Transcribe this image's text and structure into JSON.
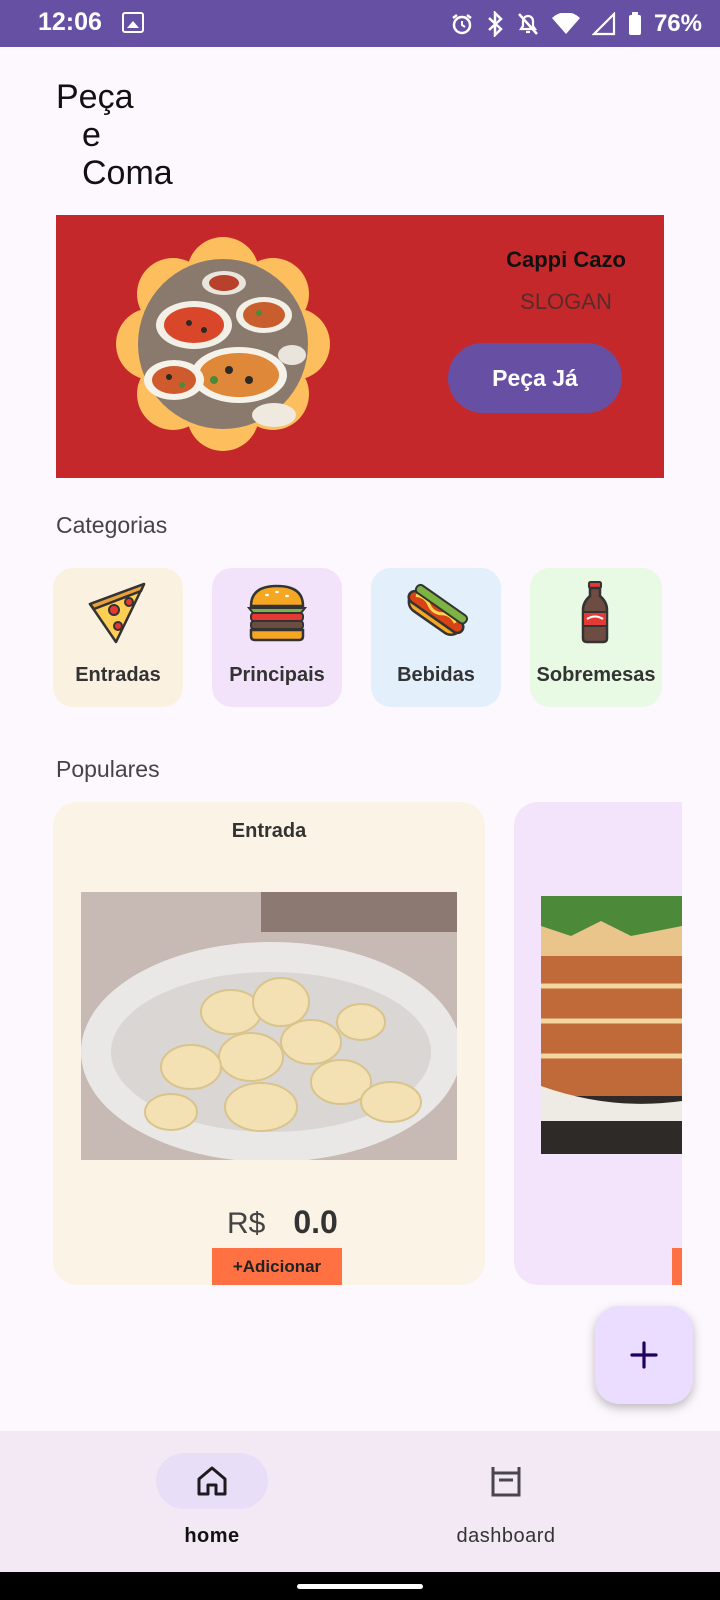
{
  "status_bar": {
    "time": "12:06",
    "battery": "76%",
    "icons": [
      "gallery-icon",
      "alarm-icon",
      "bluetooth-icon",
      "mute-icon",
      "wifi-icon",
      "signal-icon",
      "battery-icon"
    ]
  },
  "app_title": {
    "line1": "Peça",
    "line2": "e",
    "line3": "Coma"
  },
  "banner": {
    "name": "Cappi Cazo",
    "slogan": "SLOGAN",
    "cta_label": "Peça Já",
    "bg_color": "#C5282B"
  },
  "categories": {
    "title": "Categorias",
    "items": [
      {
        "label": "Entradas",
        "icon": "pizza-icon",
        "color": "#FBF1E1"
      },
      {
        "label": "Principais",
        "icon": "burger-icon",
        "color": "#F2E3FB"
      },
      {
        "label": "Bebidas",
        "icon": "hotdog-icon",
        "color": "#E3EFFB"
      },
      {
        "label": "Sobremesas",
        "icon": "soda-bottle-icon",
        "color": "#E8F9E4"
      }
    ]
  },
  "popular": {
    "title": "Populares",
    "items": [
      {
        "category": "Entrada",
        "currency": "R$",
        "price": "0.0",
        "add_label": "+Adicionar"
      }
    ]
  },
  "fab": {
    "icon": "plus-icon"
  },
  "bottom_nav": {
    "items": [
      {
        "label": "home",
        "icon": "home-icon",
        "selected": true
      },
      {
        "label": "dashboard",
        "icon": "dashboard-icon",
        "selected": false
      }
    ]
  },
  "colors": {
    "accent": "#6750A4",
    "status_bar": "#6650A4",
    "add_button": "#FF7043",
    "fab": "#EADDFF"
  }
}
